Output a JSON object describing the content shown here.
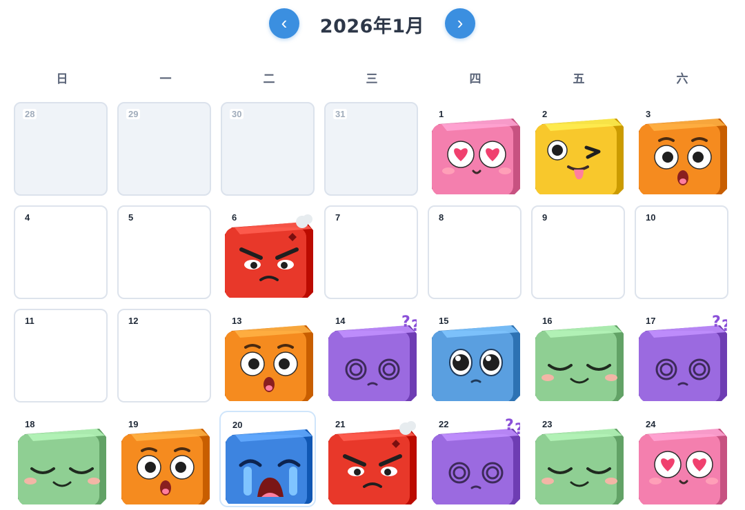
{
  "header": {
    "title": "2026年1月",
    "prev_label": "‹",
    "next_label": "›"
  },
  "weekdays": [
    "日",
    "一",
    "二",
    "三",
    "四",
    "五",
    "六"
  ],
  "mood_colors": {
    "love": "#f47fae",
    "wink": "#f8c82c",
    "surprised": "#f58b1f",
    "angry": "#e8382a",
    "confused": "#9b6ae0",
    "calm": "#5a9fe0",
    "content": "#8fcf93",
    "crying": "#3d84e0"
  },
  "days": [
    {
      "label": "28",
      "other": true
    },
    {
      "label": "29",
      "other": true
    },
    {
      "label": "30",
      "other": true
    },
    {
      "label": "31",
      "other": true
    },
    {
      "label": "1",
      "mood": "love"
    },
    {
      "label": "2",
      "mood": "wink"
    },
    {
      "label": "3",
      "mood": "surprised"
    },
    {
      "label": "4"
    },
    {
      "label": "5"
    },
    {
      "label": "6",
      "mood": "angry"
    },
    {
      "label": "7"
    },
    {
      "label": "8"
    },
    {
      "label": "9"
    },
    {
      "label": "10"
    },
    {
      "label": "11"
    },
    {
      "label": "12"
    },
    {
      "label": "13",
      "mood": "surprised"
    },
    {
      "label": "14",
      "mood": "confused"
    },
    {
      "label": "15",
      "mood": "calm"
    },
    {
      "label": "16",
      "mood": "content"
    },
    {
      "label": "17",
      "mood": "confused"
    },
    {
      "label": "18",
      "mood": "content"
    },
    {
      "label": "19",
      "mood": "surprised"
    },
    {
      "label": "20",
      "mood": "crying",
      "selected": true
    },
    {
      "label": "21",
      "mood": "angry"
    },
    {
      "label": "22",
      "mood": "confused"
    },
    {
      "label": "23",
      "mood": "content"
    },
    {
      "label": "24",
      "mood": "love"
    }
  ]
}
